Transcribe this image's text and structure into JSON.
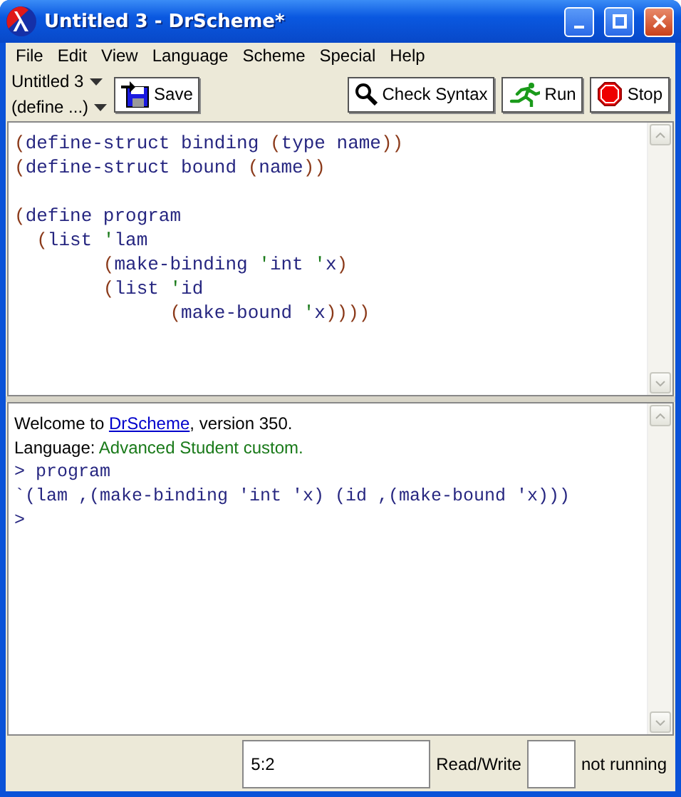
{
  "window": {
    "title": "Untitled 3 - DrScheme*"
  },
  "menu": [
    "File",
    "Edit",
    "View",
    "Language",
    "Scheme",
    "Special",
    "Help"
  ],
  "toolbar": {
    "file_selector": "Untitled 3",
    "definitions_selector": "(define ...)",
    "buttons": [
      {
        "kind": "save",
        "label": "Save"
      },
      {
        "kind": "check-syntax",
        "label": "Check Syntax"
      },
      {
        "kind": "run",
        "label": "Run"
      },
      {
        "kind": "stop",
        "label": "Stop"
      }
    ]
  },
  "definitions": [
    {
      "lines": [
        [
          {
            "kind": "paren",
            "text": "("
          },
          {
            "kind": "symbol",
            "text": "define-struct binding "
          },
          {
            "kind": "paren",
            "text": "("
          },
          {
            "kind": "symbol",
            "text": "type name"
          },
          {
            "kind": "paren",
            "text": "))"
          }
        ],
        [
          {
            "kind": "paren",
            "text": "("
          },
          {
            "kind": "symbol",
            "text": "define-struct bound "
          },
          {
            "kind": "paren",
            "text": "("
          },
          {
            "kind": "symbol",
            "text": "name"
          },
          {
            "kind": "paren",
            "text": "))"
          }
        ]
      ]
    },
    {
      "lines": [
        [
          {
            "kind": "paren",
            "text": "("
          },
          {
            "kind": "symbol",
            "text": "define program"
          }
        ],
        [
          {
            "kind": "paren",
            "text": "  ("
          },
          {
            "kind": "symbol",
            "text": "list "
          },
          {
            "kind": "quote",
            "text": "'"
          },
          {
            "kind": "symbol",
            "text": "lam"
          }
        ],
        [
          {
            "kind": "paren",
            "text": "        ("
          },
          {
            "kind": "symbol",
            "text": "make-binding "
          },
          {
            "kind": "quote",
            "text": "'"
          },
          {
            "kind": "symbol",
            "text": "int "
          },
          {
            "kind": "quote",
            "text": "'"
          },
          {
            "kind": "symbol",
            "text": "x"
          },
          {
            "kind": "paren",
            "text": ")"
          }
        ],
        [
          {
            "kind": "paren",
            "text": "        ("
          },
          {
            "kind": "symbol",
            "text": "list "
          },
          {
            "kind": "quote",
            "text": "'"
          },
          {
            "kind": "symbol",
            "text": "id"
          }
        ],
        [
          {
            "kind": "paren",
            "text": "              ("
          },
          {
            "kind": "symbol",
            "text": "make-bound "
          },
          {
            "kind": "quote",
            "text": "'"
          },
          {
            "kind": "symbol",
            "text": "x"
          },
          {
            "kind": "paren",
            "text": "))))"
          }
        ]
      ]
    }
  ],
  "interactions": [
    [
      {
        "kind": "plain",
        "text": "Welcome to "
      },
      {
        "kind": "link",
        "text": "DrScheme"
      },
      {
        "kind": "plain",
        "text": ", version 350."
      }
    ],
    [
      {
        "kind": "plain",
        "text": "Language: "
      },
      {
        "kind": "language",
        "text": "Advanced Student custom."
      }
    ],
    [
      {
        "kind": "code",
        "text": "> program"
      }
    ],
    [
      {
        "kind": "code",
        "text": "`(lam ,(make-binding 'int 'x) (id ,(make-bound 'x)))"
      }
    ],
    [
      {
        "kind": "code",
        "text": ">"
      }
    ]
  ],
  "status_bar": {
    "position": "5:2",
    "mode": "Read/Write",
    "state": "not running"
  }
}
